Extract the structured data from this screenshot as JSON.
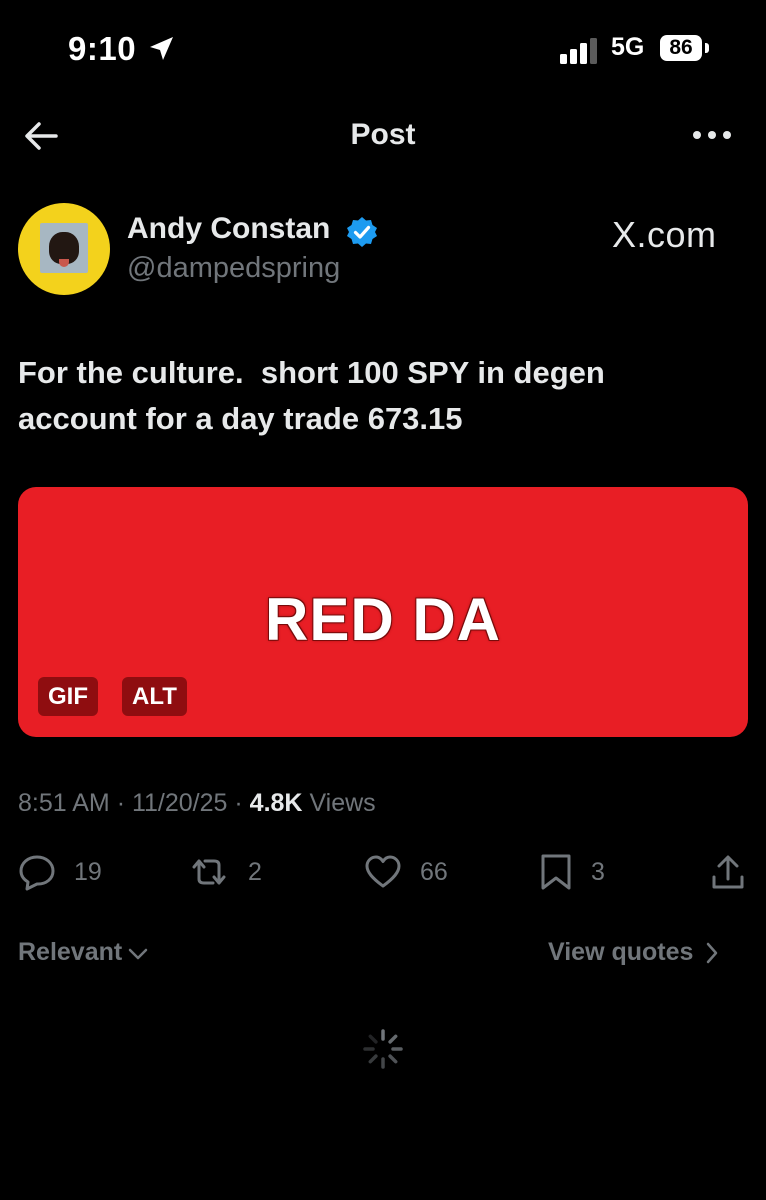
{
  "status_bar": {
    "time": "9:10",
    "network": "5G",
    "battery": "86"
  },
  "nav": {
    "title": "Post",
    "back_icon": "arrow-left-icon",
    "more_icon": "more-horizontal-icon"
  },
  "author": {
    "name": "Andy Constan",
    "handle": "@dampedspring",
    "verified_color": "#1d9bf0",
    "avatar_bg": "#f3d21c"
  },
  "watermark": "X.com",
  "post": {
    "text": "For the culture.  short 100 SPY in degen\naccount for a day trade 673.15"
  },
  "media": {
    "text": "RED DA",
    "badges": [
      "GIF",
      "ALT"
    ],
    "bg_color": "#e81e25"
  },
  "meta": {
    "time": "8:51 AM",
    "date": "11/20/25",
    "views_count": "4.8K",
    "views_label": "Views",
    "separator": "·"
  },
  "actions": {
    "reply": "19",
    "repost": "2",
    "like": "66",
    "bookmark": "3"
  },
  "replies": {
    "sort_label": "Relevant",
    "view_quotes_label": "View quotes"
  },
  "colors": {
    "background": "#000000",
    "text": "#e7e9ea",
    "muted": "#71767b"
  }
}
